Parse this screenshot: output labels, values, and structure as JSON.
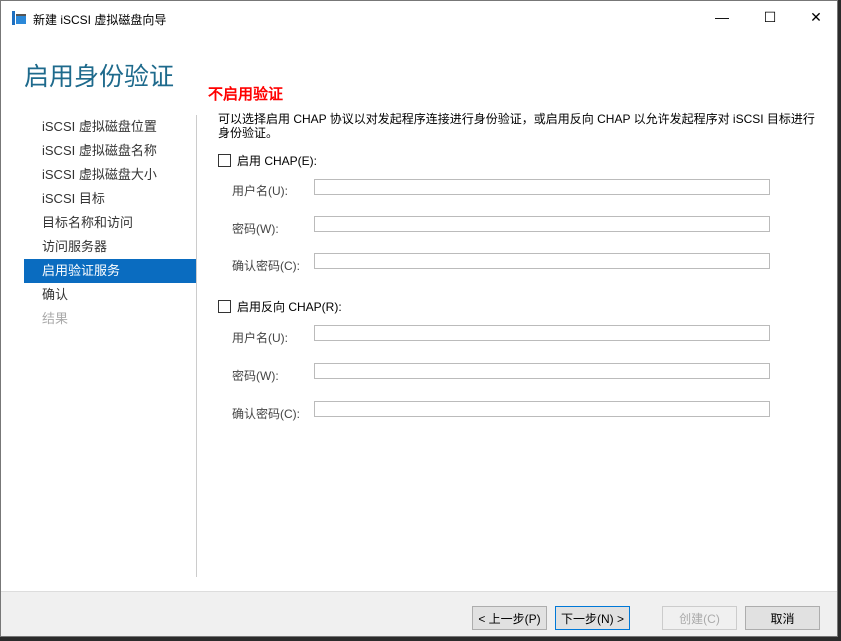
{
  "window": {
    "title": "新建 iSCSI 虚拟磁盘向导",
    "minimize": "—",
    "maximize": "☐",
    "close": "✕"
  },
  "heading": "启用身份验证",
  "sidebar": {
    "items": [
      {
        "label": "iSCSI 虚拟磁盘位置",
        "state": "normal"
      },
      {
        "label": "iSCSI 虚拟磁盘名称",
        "state": "normal"
      },
      {
        "label": "iSCSI 虚拟磁盘大小",
        "state": "normal"
      },
      {
        "label": "iSCSI 目标",
        "state": "normal"
      },
      {
        "label": "目标名称和访问",
        "state": "normal"
      },
      {
        "label": "访问服务器",
        "state": "normal"
      },
      {
        "label": "启用验证服务",
        "state": "active"
      },
      {
        "label": "确认",
        "state": "normal"
      },
      {
        "label": "结果",
        "state": "disabled"
      }
    ]
  },
  "main": {
    "section_title": "不启用验证",
    "description": "可以选择启用 CHAP 协议以对发起程序连接进行身份验证，或启用反向 CHAP 以允许发起程序对 iSCSI 目标进行身份验证。",
    "chap": {
      "label": "启用 CHAP(E):",
      "checked": false,
      "username_label": "用户名(U):",
      "username": "",
      "password_label": "密码(W):",
      "password": "",
      "confirm_label": "确认密码(C):",
      "confirm": ""
    },
    "reverse_chap": {
      "label": "启用反向 CHAP(R):",
      "checked": false,
      "username_label": "用户名(U):",
      "username": "",
      "password_label": "密码(W):",
      "password": "",
      "confirm_label": "确认密码(C):",
      "confirm": ""
    }
  },
  "footer": {
    "prev": "< 上一步(P)",
    "next": "下一步(N) >",
    "create": "创建(C)",
    "cancel": "取消"
  }
}
